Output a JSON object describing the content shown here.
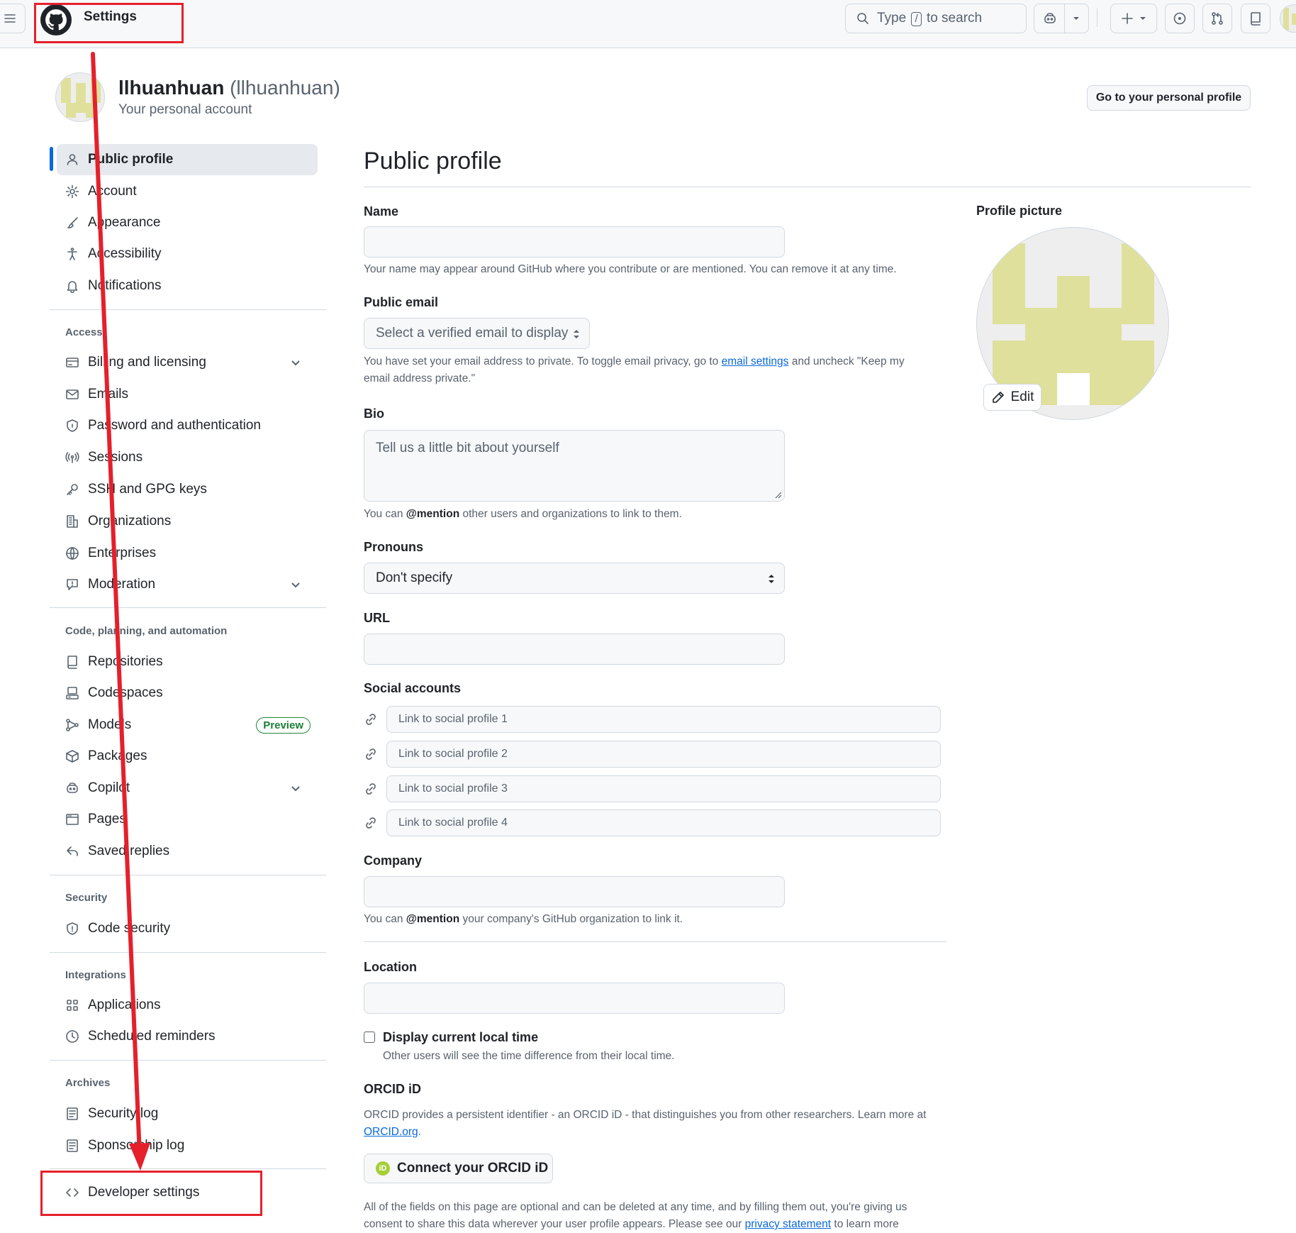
{
  "header": {
    "context_title": "Settings",
    "search": {
      "prefix": "Type",
      "key": "/",
      "suffix": "to search"
    }
  },
  "account": {
    "name": "llhuanhuan",
    "login": "(llhuanhuan)",
    "subtitle": "Your personal account",
    "profile_button": "Go to your personal profile"
  },
  "sidebar": {
    "top_items": [
      {
        "label": "Public profile",
        "icon": "person-icon",
        "active": true
      },
      {
        "label": "Account",
        "icon": "gear-icon"
      },
      {
        "label": "Appearance",
        "icon": "paintbrush-icon"
      },
      {
        "label": "Accessibility",
        "icon": "accessibility-icon"
      },
      {
        "label": "Notifications",
        "icon": "bell-icon"
      }
    ],
    "access": {
      "heading": "Access",
      "items": [
        {
          "label": "Billing and licensing",
          "icon": "credit-card-icon",
          "expandable": true
        },
        {
          "label": "Emails",
          "icon": "mail-icon"
        },
        {
          "label": "Password and authentication",
          "icon": "shield-lock-icon"
        },
        {
          "label": "Sessions",
          "icon": "broadcast-icon"
        },
        {
          "label": "SSH and GPG keys",
          "icon": "key-icon"
        },
        {
          "label": "Organizations",
          "icon": "organization-icon"
        },
        {
          "label": "Enterprises",
          "icon": "globe-icon"
        },
        {
          "label": "Moderation",
          "icon": "report-icon",
          "expandable": true
        }
      ]
    },
    "code": {
      "heading": "Code, planning, and automation",
      "items": [
        {
          "label": "Repositories",
          "icon": "repo-icon"
        },
        {
          "label": "Codespaces",
          "icon": "codespaces-icon"
        },
        {
          "label": "Models",
          "icon": "models-icon",
          "badge": "Preview"
        },
        {
          "label": "Packages",
          "icon": "package-icon"
        },
        {
          "label": "Copilot",
          "icon": "copilot-icon",
          "expandable": true
        },
        {
          "label": "Pages",
          "icon": "browser-icon"
        },
        {
          "label": "Saved replies",
          "icon": "reply-icon"
        }
      ]
    },
    "security": {
      "heading": "Security",
      "items": [
        {
          "label": "Code security",
          "icon": "shield-icon"
        }
      ]
    },
    "integrations": {
      "heading": "Integrations",
      "items": [
        {
          "label": "Applications",
          "icon": "apps-icon"
        },
        {
          "label": "Scheduled reminders",
          "icon": "clock-icon"
        }
      ]
    },
    "archives": {
      "heading": "Archives",
      "items": [
        {
          "label": "Security log",
          "icon": "log-icon"
        },
        {
          "label": "Sponsorship log",
          "icon": "log-icon"
        }
      ]
    },
    "developer": {
      "label": "Developer settings",
      "icon": "code-icon"
    }
  },
  "main": {
    "title": "Public profile",
    "name": {
      "label": "Name",
      "value": "",
      "note": "Your name may appear around GitHub where you contribute or are mentioned. You can remove it at any time."
    },
    "public_email": {
      "label": "Public email",
      "selected": "Select a verified email to display",
      "note_1": "You have set your email address to private. To toggle email privacy, go to",
      "note_link": "email settings",
      "note_2": "and uncheck \"Keep my",
      "note_3": "email address private.\""
    },
    "bio": {
      "label": "Bio",
      "placeholder": "Tell us a little bit about yourself",
      "note_1": "You can",
      "note_mention": "@mention",
      "note_2": "other users and organizations to link to them."
    },
    "pronouns": {
      "label": "Pronouns",
      "selected": "Don't specify"
    },
    "url": {
      "label": "URL",
      "value": ""
    },
    "social": {
      "label": "Social accounts",
      "placeholders": [
        "Link to social profile 1",
        "Link to social profile 2",
        "Link to social profile 3",
        "Link to social profile 4"
      ]
    },
    "company": {
      "label": "Company",
      "note_1": "You can",
      "note_mention": "@mention",
      "note_2": "your company's GitHub organization to link it."
    },
    "location": {
      "label": "Location"
    },
    "local_time": {
      "label": "Display current local time",
      "checked": false,
      "note": "Other users will see the time difference from their local time."
    },
    "orcid": {
      "label": "ORCID iD",
      "note_1": "ORCID provides a persistent identifier - an ORCID iD - that distinguishes you from other researchers. Learn more at",
      "note_link": "ORCID.org",
      "note_end": ".",
      "button": "Connect your ORCID iD",
      "logo_text": "iD"
    },
    "footer": {
      "line_1": "All of the fields on this page are optional and can be deleted at any time, and by filling them out, you're giving us",
      "line_2a": "consent to share this data wherever your user profile appears. Please see our",
      "line_2_link": "privacy statement",
      "line_2b": "to learn more"
    }
  },
  "profile_picture": {
    "label": "Profile picture",
    "edit_label": "Edit"
  },
  "colors": {
    "accent": "#0969da",
    "annotation": "#e5202b",
    "identicon": "#dfe09c"
  }
}
